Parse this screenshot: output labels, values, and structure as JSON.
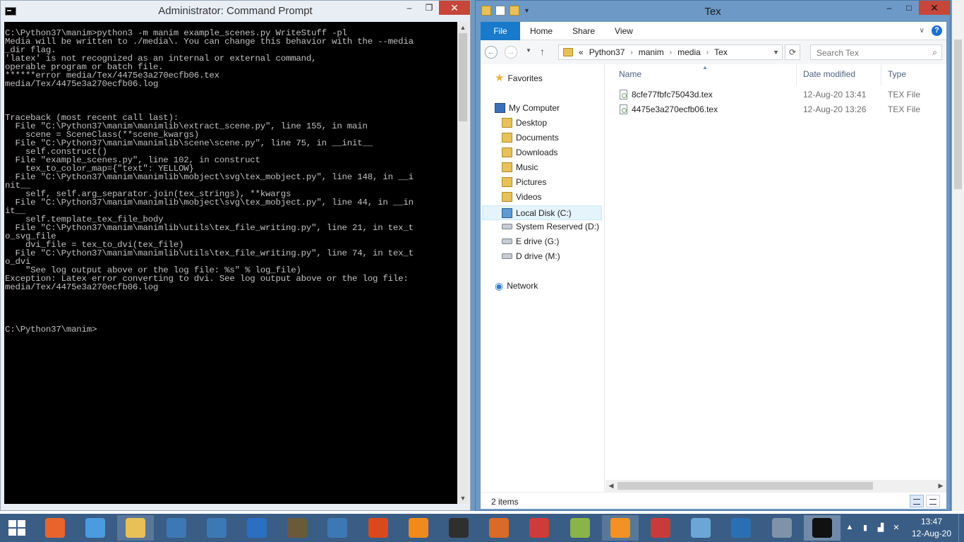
{
  "cmd_window": {
    "title": "Administrator: Command Prompt",
    "console_lines": [
      "C:\\Python37\\manim>python3 -m manim example_scenes.py WriteStuff -pl",
      "Media will be written to ./media\\. You can change this behavior with the --media",
      "_dir flag.",
      "'latex' is not recognized as an internal or external command,",
      "operable program or batch file.",
      "******error media/Tex/4475e3a270ecfb06.tex",
      "media/Tex/4475e3a270ecfb06.log",
      "",
      "",
      "",
      "Traceback (most recent call last):",
      "  File \"C:\\Python37\\manim\\manimlib\\extract_scene.py\", line 155, in main",
      "    scene = SceneClass(**scene_kwargs)",
      "  File \"C:\\Python37\\manim\\manimlib\\scene\\scene.py\", line 75, in __init__",
      "    self.construct()",
      "  File \"example_scenes.py\", line 102, in construct",
      "    tex_to_color_map={\"text\": YELLOW}",
      "  File \"C:\\Python37\\manim\\manimlib\\mobject\\svg\\tex_mobject.py\", line 148, in __i",
      "nit__",
      "    self, self.arg_separator.join(tex_strings), **kwargs",
      "  File \"C:\\Python37\\manim\\manimlib\\mobject\\svg\\tex_mobject.py\", line 44, in __in",
      "it__",
      "    self.template_tex_file_body",
      "  File \"C:\\Python37\\manim\\manimlib\\utils\\tex_file_writing.py\", line 21, in tex_t",
      "o_svg_file",
      "    dvi_file = tex_to_dvi(tex_file)",
      "  File \"C:\\Python37\\manim\\manimlib\\utils\\tex_file_writing.py\", line 74, in tex_t",
      "o_dvi",
      "    \"See log output above or the log file: %s\" % log_file)",
      "Exception: Latex error converting to dvi. See log output above or the log file:",
      "media/Tex/4475e3a270ecfb06.log",
      "",
      "",
      "",
      "",
      "C:\\Python37\\manim>"
    ],
    "buttons": {
      "minimize": "–",
      "maximize": "❐",
      "close": "✕"
    }
  },
  "explorer": {
    "title": "Tex",
    "ribbon_tabs": [
      "File",
      "Home",
      "Share",
      "View"
    ],
    "help": "?",
    "address": {
      "prefix": "«",
      "crumbs": [
        "Python37",
        "manim",
        "media",
        "Tex"
      ]
    },
    "search_placeholder": "Search Tex",
    "nav": {
      "favorites": "Favorites",
      "computer": "My Computer",
      "folders": [
        "Desktop",
        "Documents",
        "Downloads",
        "Music",
        "Pictures",
        "Videos"
      ],
      "drives": [
        "Local Disk (C:)",
        "System Reserved (D:)",
        "E drive (G:)",
        "D drive (M:)"
      ],
      "network": "Network"
    },
    "columns": {
      "name": "Name",
      "date": "Date modified",
      "type": "Type"
    },
    "files": [
      {
        "name": "8cfe77fbfc75043d.tex",
        "date": "12-Aug-20 13:41",
        "type": "TEX File"
      },
      {
        "name": "4475e3a270ecfb06.tex",
        "date": "12-Aug-20 13:26",
        "type": "TEX File"
      }
    ],
    "status": "2 items"
  },
  "taskbar": {
    "apps": [
      {
        "name": "firefox",
        "color": "#e8642c"
      },
      {
        "name": "media-player",
        "color": "#4a9be0"
      },
      {
        "name": "file-explorer",
        "color": "#e7c05a"
      },
      {
        "name": "python-idle-1",
        "color": "#3c78b4"
      },
      {
        "name": "python-idle-2",
        "color": "#3c78b4"
      },
      {
        "name": "thunderbird",
        "color": "#2a6fc2"
      },
      {
        "name": "stellarium",
        "color": "#6b5a3a"
      },
      {
        "name": "python-idle-3",
        "color": "#3c78b4"
      },
      {
        "name": "ms-office",
        "color": "#d84a1b"
      },
      {
        "name": "vlc",
        "color": "#f08a1c"
      },
      {
        "name": "chess",
        "color": "#2f2f2f"
      },
      {
        "name": "matlab",
        "color": "#d86a2a"
      },
      {
        "name": "geogebra",
        "color": "#cf3a3a"
      },
      {
        "name": "notepad-plus",
        "color": "#8ab447"
      },
      {
        "name": "sublime-text",
        "color": "#f29222"
      },
      {
        "name": "snipping-tool",
        "color": "#c93b3b"
      },
      {
        "name": "paint",
        "color": "#6aa6d6"
      },
      {
        "name": "powershell",
        "color": "#2b6fb3"
      },
      {
        "name": "device-manager",
        "color": "#7e93a8"
      },
      {
        "name": "command-prompt",
        "color": "#111111"
      }
    ],
    "clock_time": "13:47",
    "clock_date": "12-Aug-20"
  }
}
